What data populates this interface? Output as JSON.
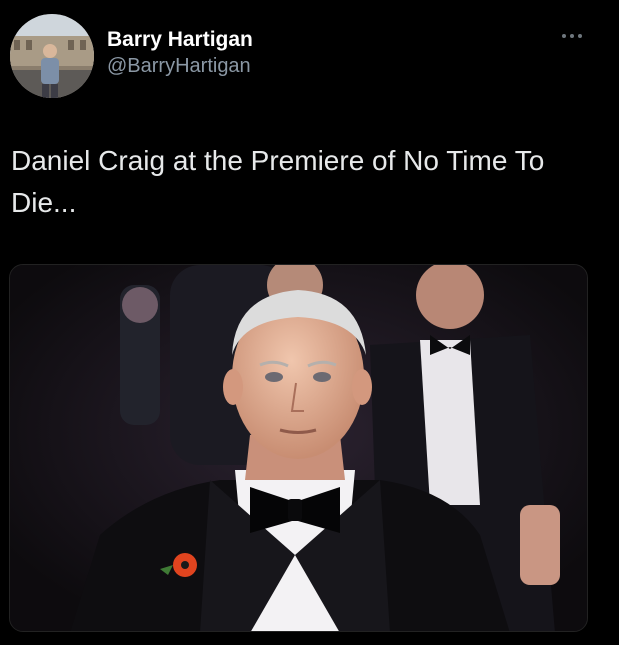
{
  "author": {
    "display_name": "Barry Hartigan",
    "handle": "@BarryHartigan",
    "avatar_icon": "profile-photo-icon"
  },
  "menu": {
    "icon": "more-options-icon"
  },
  "tweet": {
    "text": "Daniel Craig at the Premiere of No Time To Die..."
  },
  "media": {
    "icon": "photo-man-in-tuxedo-icon"
  },
  "colors": {
    "background": "#000000",
    "text": "#e7e9ea",
    "secondary_text": "#8b98a5"
  }
}
